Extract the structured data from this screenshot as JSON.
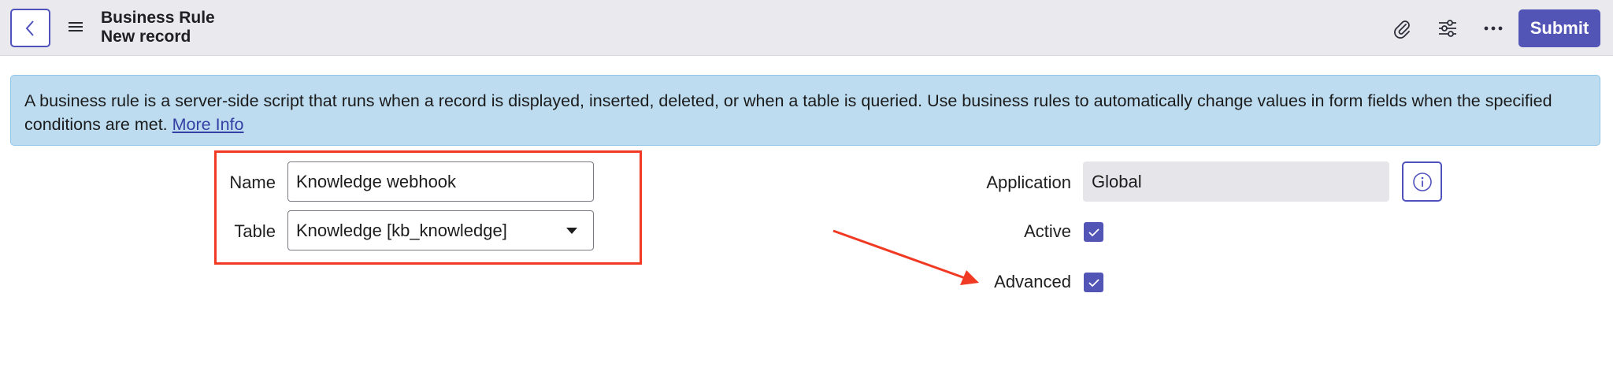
{
  "header": {
    "title": "Business Rule",
    "subtitle": "New record",
    "submit_label": "Submit"
  },
  "banner": {
    "text": "A business rule is a server-side script that runs when a record is displayed, inserted, deleted, or when a table is queried. Use business rules to automatically change values in form fields when the specified conditions are met.",
    "link": "More Info"
  },
  "form": {
    "name": {
      "label": "Name",
      "value": "Knowledge webhook"
    },
    "table": {
      "label": "Table",
      "value": "Knowledge [kb_knowledge]"
    },
    "application": {
      "label": "Application",
      "value": "Global"
    },
    "active": {
      "label": "Active",
      "checked": true
    },
    "advanced": {
      "label": "Advanced",
      "checked": true
    }
  },
  "colors": {
    "accent": "#5255b6",
    "header_bg": "#e9e9ee",
    "banner_bg": "#bddcf0",
    "annotation_red": "#f03a24"
  },
  "icons": [
    "chevron-left-icon",
    "hamburger-menu-icon",
    "paperclip-icon",
    "sliders-icon",
    "more-horizontal-icon",
    "info-icon",
    "checkmark-icon"
  ]
}
